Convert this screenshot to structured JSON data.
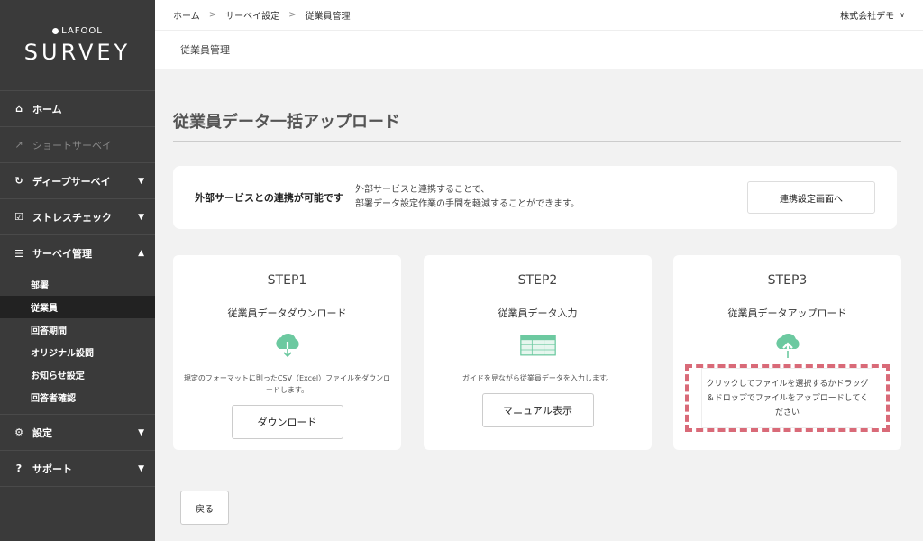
{
  "brand": {
    "top": "LAFOOL",
    "main": "SURVEY"
  },
  "nav": {
    "home": "ホーム",
    "short_survey": "ショートサーベイ",
    "deep_survey": "ディープサーベイ",
    "stress_check": "ストレスチェック",
    "survey_mgmt": "サーベイ管理",
    "sub_items": [
      "部署",
      "従業員",
      "回答期間",
      "オリジナル設問",
      "お知らせ設定",
      "回答者確認"
    ],
    "settings": "設定",
    "support": "サポート"
  },
  "breadcrumb": [
    "ホーム",
    "サーベイ設定",
    "従業員管理"
  ],
  "company": "株式会社デモ",
  "subheader": "従業員管理",
  "page_title": "従業員データ一括アップロード",
  "info": {
    "label": "外部サービスとの連携が可能です",
    "desc_line1": "外部サービスと連携することで、",
    "desc_line2": "部署データ設定作業の手間を軽減することができます。",
    "button": "連携設定画面へ"
  },
  "steps": [
    {
      "title": "STEP1",
      "subtitle": "従業員データダウンロード",
      "desc": "規定のフォーマットに則ったCSV（Excel）ファイルをダウンロードします。",
      "button": "ダウンロード"
    },
    {
      "title": "STEP2",
      "subtitle": "従業員データ入力",
      "desc": "ガイドを見ながら従業員データを入力します。",
      "button": "マニュアル表示"
    },
    {
      "title": "STEP3",
      "subtitle": "従業員データアップロード",
      "dropzone": "クリックしてファイルを選択するかドラッグ＆ドロップでファイルをアップロードしてください"
    }
  ],
  "back_button": "戻る",
  "colors": {
    "sidebar": "#3a3a3a",
    "accent_green": "#6cc9a0",
    "dropzone_border": "#d96a78"
  }
}
